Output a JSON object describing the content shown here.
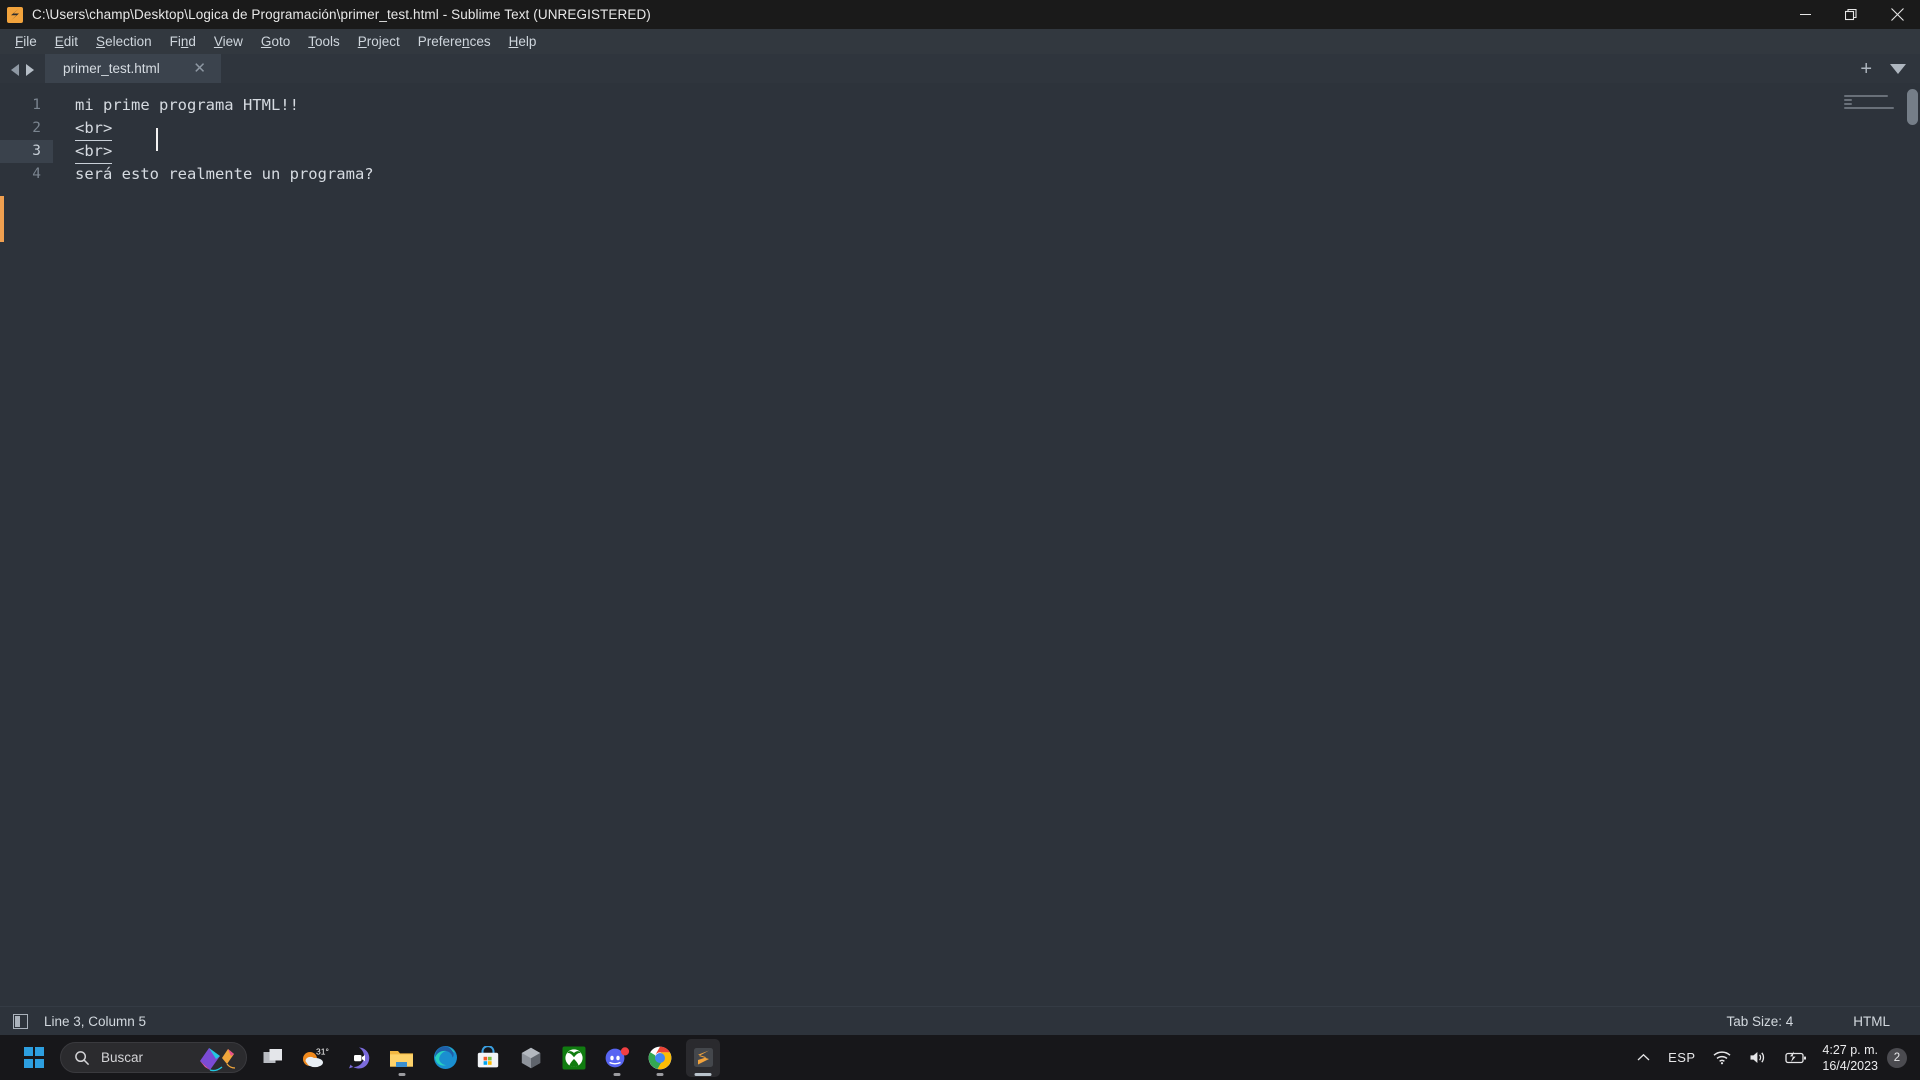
{
  "titlebar": {
    "title": "C:\\Users\\champ\\Desktop\\Logica de Programación\\primer_test.html - Sublime Text (UNREGISTERED)",
    "logo_icon": "sublime-text-logo",
    "minimize_icon": "minimize-icon",
    "restore_icon": "restore-icon",
    "close_icon": "close-icon"
  },
  "menubar": {
    "items": [
      {
        "label": "File",
        "accel": "F"
      },
      {
        "label": "Edit",
        "accel": "E"
      },
      {
        "label": "Selection",
        "accel": "S"
      },
      {
        "label": "Find",
        "accel": "n"
      },
      {
        "label": "View",
        "accel": "V"
      },
      {
        "label": "Goto",
        "accel": "G"
      },
      {
        "label": "Tools",
        "accel": "T"
      },
      {
        "label": "Project",
        "accel": "P"
      },
      {
        "label": "Preferences",
        "accel": "n"
      },
      {
        "label": "Help",
        "accel": "H"
      }
    ]
  },
  "tabbar": {
    "prev_icon": "arrow-left-icon",
    "next_icon": "arrow-right-icon",
    "tabs": [
      {
        "label": "primer_test.html",
        "close_icon": "close-tab-icon",
        "active": true
      }
    ],
    "new_tab_label": "+",
    "dropdown_icon": "chevron-down-icon"
  },
  "editor": {
    "lines": [
      {
        "number": "1",
        "text": "mi prime programa HTML!!",
        "underlined": false,
        "active": false
      },
      {
        "number": "2",
        "text": "<br>",
        "underlined": true,
        "active": false
      },
      {
        "number": "3",
        "text": "<br>",
        "underlined": true,
        "active": true
      },
      {
        "number": "4",
        "text": "será esto realmente un programa?",
        "underlined": false,
        "active": false
      }
    ],
    "caret_color": "#f0a050",
    "background": "#2d333b",
    "text_color": "#d6dbe1"
  },
  "statusbar": {
    "sidebar_icon": "sidebar-toggle-icon",
    "position": "Line 3, Column 5",
    "tab_size": "Tab Size: 4",
    "syntax": "HTML"
  },
  "taskbar": {
    "start_icon": "windows-start-icon",
    "search": {
      "icon": "search-icon",
      "placeholder": "Buscar",
      "art_icon": "kite-illustration-icon"
    },
    "apps": [
      {
        "name": "task-view-icon",
        "label": "",
        "running": false
      },
      {
        "name": "weather-icon",
        "label": "31°",
        "running": false
      },
      {
        "name": "teams-icon",
        "label": "",
        "running": false
      },
      {
        "name": "file-explorer-icon",
        "label": "",
        "running": true
      },
      {
        "name": "edge-icon",
        "label": "",
        "running": false
      },
      {
        "name": "microsoft-store-icon",
        "label": "",
        "running": false
      },
      {
        "name": "copilot-icon",
        "label": "",
        "running": false
      },
      {
        "name": "xbox-icon",
        "label": "",
        "running": false
      },
      {
        "name": "discord-icon",
        "label": "",
        "running": true
      },
      {
        "name": "chrome-icon",
        "label": "",
        "running": true
      },
      {
        "name": "sublime-text-icon",
        "label": "",
        "running": true,
        "active": true
      }
    ],
    "tray": {
      "overflow_icon": "chevron-up-icon",
      "language": "ESP",
      "wifi_icon": "wifi-icon",
      "volume_icon": "speaker-icon",
      "battery_icon": "battery-charging-icon",
      "time": "4:27 p. m.",
      "date": "16/4/2023",
      "notification_count": "2"
    }
  }
}
